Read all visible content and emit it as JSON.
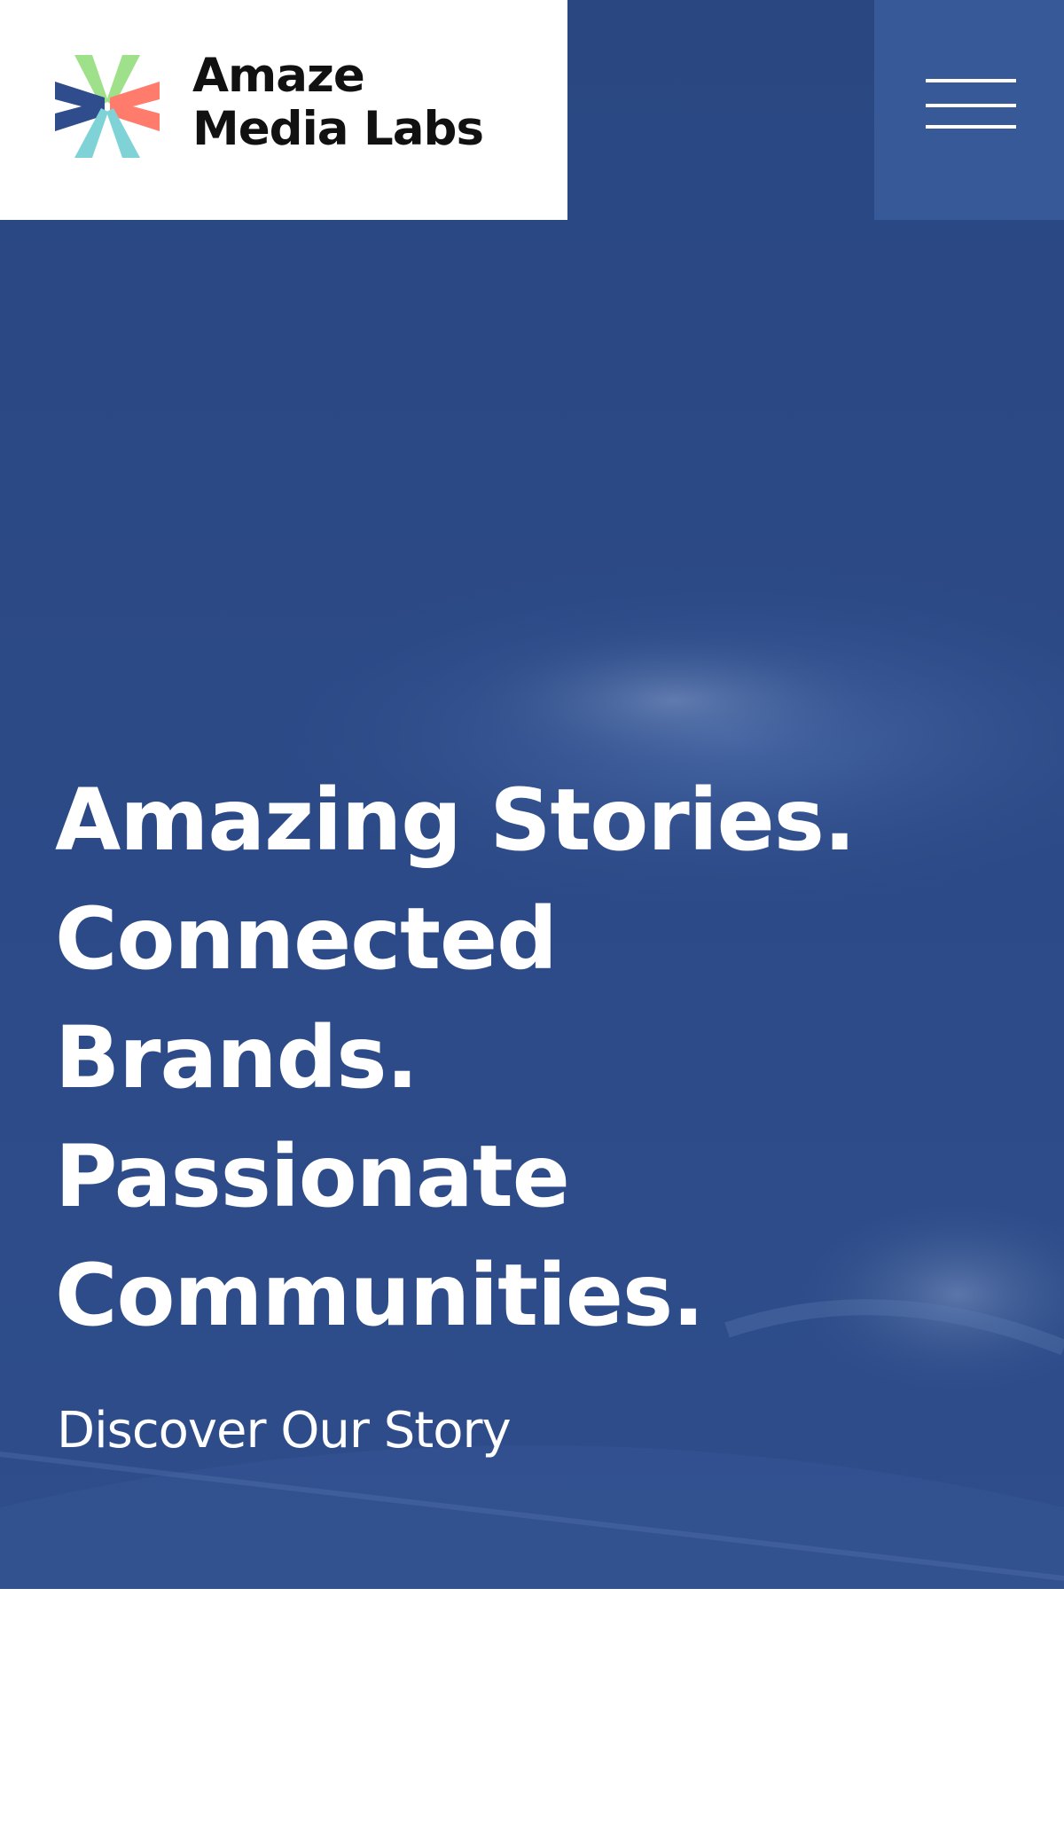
{
  "brand": {
    "name_line1": "Amaze",
    "name_line2": "Media Labs",
    "logo_colors": {
      "green": "#9fe08a",
      "coral": "#ff7b6b",
      "blue": "#2f4c8c",
      "teal": "#7fd3d6"
    }
  },
  "header": {
    "menu_icon": "hamburger-menu-icon",
    "menu_bg": "#375998"
  },
  "hero": {
    "headline_lines": [
      "Amazing Stories.",
      "Connected",
      "Brands.",
      "Passionate",
      "Communities."
    ],
    "cta_label": "Discover Our Story",
    "overlay_color": "#2b4a86"
  }
}
